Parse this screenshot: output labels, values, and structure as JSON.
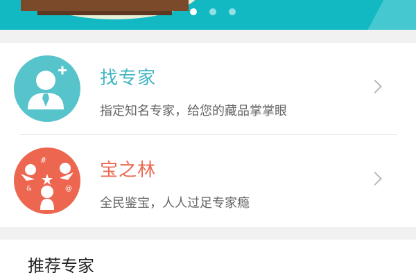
{
  "banner": {
    "slide_count": 3,
    "active_slide": 1
  },
  "services": [
    {
      "title": "找专家",
      "subtitle": "指定知名专家，给您的藏品掌掌眼",
      "icon": "add-user-icon",
      "color": "#40b6c2"
    },
    {
      "title": "宝之林",
      "subtitle": "全民鉴宝，人人过足专家瘾",
      "icon": "community-icon",
      "color": "#ea6a52"
    }
  ],
  "recommend": {
    "title": "推荐专家"
  }
}
